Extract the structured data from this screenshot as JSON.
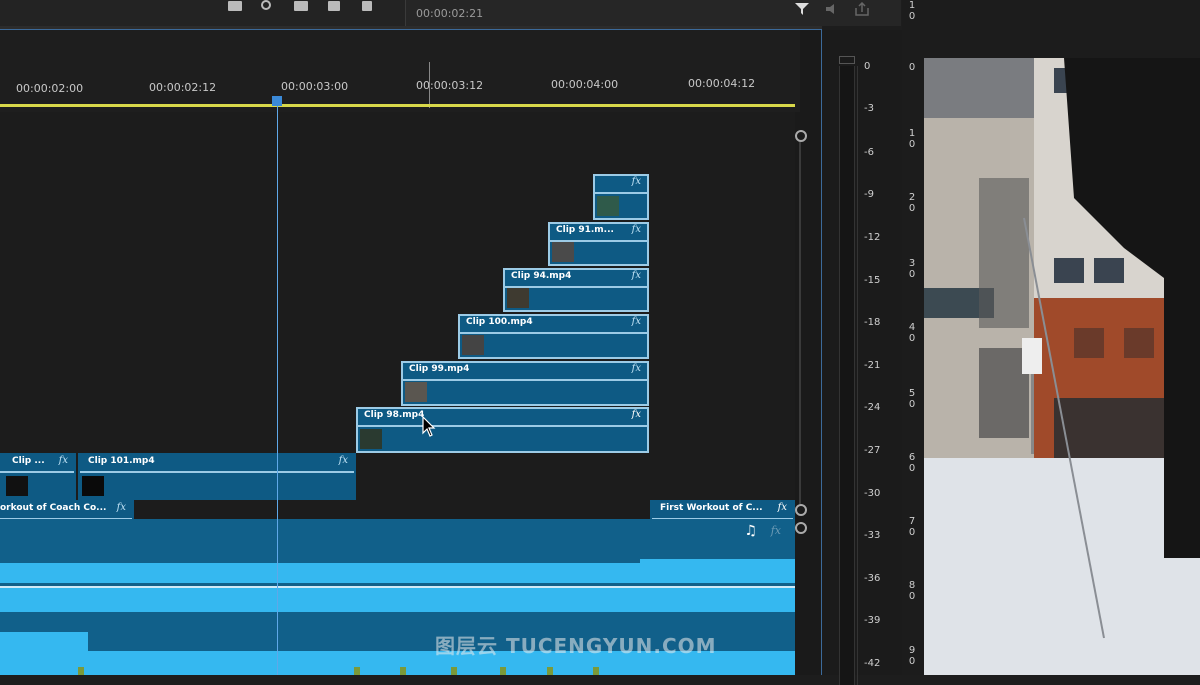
{
  "toolbar": {
    "timecode": "00:00:02:21",
    "icons": [
      "ripple-edit-icon",
      "search-icon",
      "markers-icon",
      "linked-selection-icon",
      "trash-icon",
      "filter-icon",
      "audio-out-icon",
      "export-icon"
    ]
  },
  "ruler": {
    "labels": [
      "00:00:02:00",
      "00:00:02:12",
      "00:00:03:00",
      "00:00:03:12",
      "00:00:04:00",
      "00:00:04:12"
    ]
  },
  "clips": {
    "v8": {
      "name": "",
      "fx": "fx"
    },
    "v7": {
      "name": "Clip 91.m...",
      "fx": "fx"
    },
    "v6": {
      "name": "Clip 94.mp4",
      "fx": "fx"
    },
    "v5": {
      "name": "Clip 100.mp4",
      "fx": "fx"
    },
    "v4": {
      "name": "Clip 99.mp4",
      "fx": "fx"
    },
    "v3": {
      "name": "Clip 98.mp4",
      "fx": "fx"
    },
    "v2a": {
      "name": "Clip ...",
      "fx": "fx"
    },
    "v2b": {
      "name": "Clip 101.mp4",
      "fx": "fx"
    },
    "v1a": {
      "name": "orkout of Coach Co...",
      "fx": "fx"
    },
    "v1b": {
      "name": "First Workout of C...",
      "fx": "fx"
    }
  },
  "audio": {
    "fx": "fx",
    "icon": "music-note-icon"
  },
  "meters": {
    "labels": [
      "0",
      "-3",
      "-6",
      "-9",
      "-12",
      "-15",
      "-18",
      "-21",
      "-24",
      "-27",
      "-30",
      "-33",
      "-36",
      "-39",
      "-42"
    ]
  },
  "rstrip": {
    "labels": [
      "1\n0",
      "0",
      "1\n0",
      "2\n0",
      "3\n0",
      "4\n0",
      "5\n0",
      "6\n0",
      "7\n0",
      "8\n0",
      "9\n0"
    ]
  },
  "watermark": "图层云  TUCENGYUN.COM",
  "colors": {
    "clip": "#0e5a84",
    "clip_border": "#9ccbe6",
    "playhead": "#5fa8e8",
    "ruler_bar": "#d8d84a",
    "audio_wave": "#35b8f0"
  }
}
